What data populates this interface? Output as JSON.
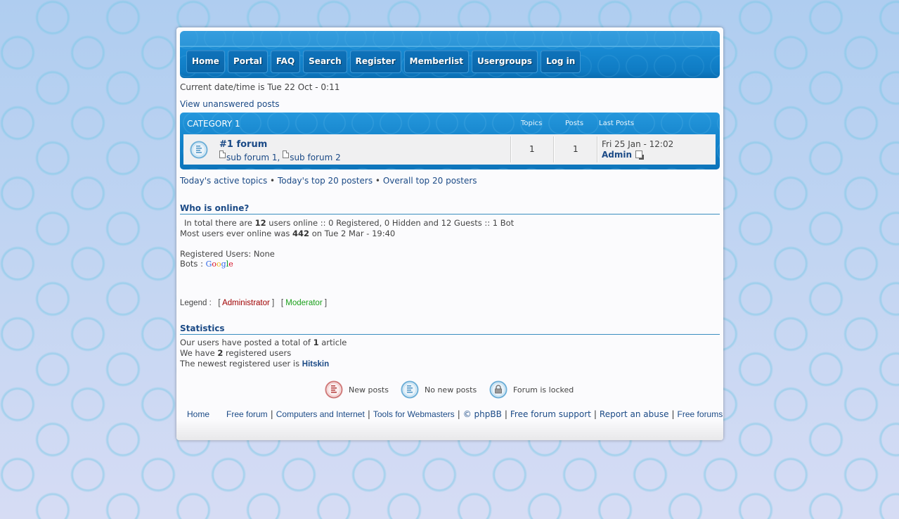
{
  "nav": {
    "items": [
      {
        "label": "Home"
      },
      {
        "label": "Portal"
      },
      {
        "label": "FAQ"
      },
      {
        "label": "Search"
      },
      {
        "label": "Register"
      },
      {
        "label": "Memberlist"
      },
      {
        "label": "Usergroups"
      },
      {
        "label": "Log in"
      }
    ]
  },
  "datetime": "Current date/time is Tue 22 Oct - 0:11",
  "unanswered_link": "View unanswered posts",
  "category": {
    "title": "CATEGORY 1",
    "columns": {
      "topics": "Topics",
      "posts": "Posts",
      "last_posts": "Last Posts"
    },
    "forums": [
      {
        "icon": "no-new-posts-icon",
        "name": "#1 forum",
        "subforums": [
          "sub forum 1",
          "sub forum 2"
        ],
        "subforum_separator": ",",
        "topics": "1",
        "posts": "1",
        "last_post_date": "Fri 25 Jan - 12:02",
        "last_post_user": "Admin"
      }
    ]
  },
  "quick_links": {
    "items": [
      "Today's active topics",
      "Today's top 20 posters",
      "Overall top 20 posters"
    ],
    "separator": "•"
  },
  "who_is_online": {
    "title": "Who is online?",
    "line1": {
      "pre": "In total there are ",
      "count": "12",
      "post": " users online :: 0 Registered, 0 Hidden and 12 Guests :: 1 Bot"
    },
    "line2": {
      "pre": "Most users ever online was ",
      "count": "442",
      "post": " on Tue 2 Mar - 19:40"
    },
    "registered_users": "Registered Users: None",
    "bots_label": "Bots : ",
    "bot_name": [
      "G",
      "o",
      "o",
      "g",
      "l",
      "e"
    ]
  },
  "legend": {
    "label": "Legend :",
    "administrator": "Administrator",
    "moderator": "Moderator",
    "admin_color": "#a00000",
    "mod_color": "#1aa01a"
  },
  "statistics": {
    "title": "Statistics",
    "line1": {
      "pre": "Our users have posted a total of ",
      "count": "1",
      "post": " article"
    },
    "line2": {
      "pre": "We have ",
      "count": "2",
      "post": " registered users"
    },
    "line3": {
      "pre": "The newest registered user is ",
      "user": "Hitskin"
    }
  },
  "icon_legend": {
    "new_posts": "New posts",
    "no_new_posts": "No new posts",
    "locked": "Forum is locked"
  },
  "footer": {
    "home": "Home",
    "links": [
      "Free forum",
      "Computers and Internet",
      "Tools for Webmasters",
      "© phpBB",
      "Free forum support",
      "Report an abuse",
      "Free forums"
    ],
    "separator": "|"
  },
  "colors": {
    "accent": "#1789d2",
    "link": "#1b4a86",
    "new_posts_icon": "#c0504d",
    "no_new_posts_icon": "#5aa5d2"
  }
}
